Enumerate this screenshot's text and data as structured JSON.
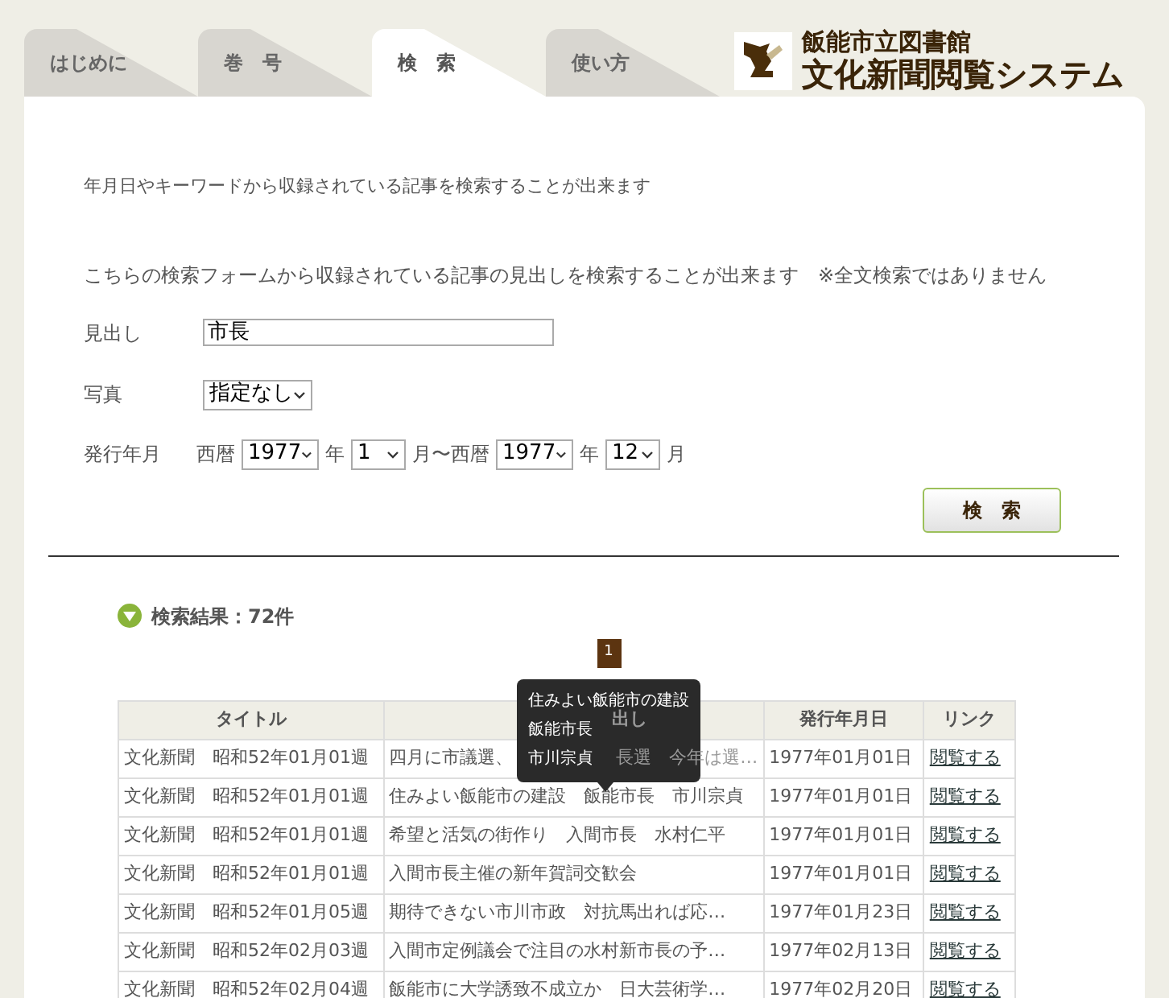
{
  "tabs": [
    {
      "label": "はじめに",
      "selected": false
    },
    {
      "label": "巻　号",
      "selected": false
    },
    {
      "label": "検　索",
      "selected": true
    },
    {
      "label": "使い方",
      "selected": false
    }
  ],
  "logo": {
    "subtitle": "飯能市立図書館",
    "title": "文化新聞閲覧システム"
  },
  "intro": "年月日やキーワードから収録されている記事を検索することが出来ます",
  "form": {
    "description": "こちらの検索フォームから収録されている記事の見出しを検索することが出来ます　※全文検索ではありません",
    "headline": {
      "label": "見出し",
      "value": "市長"
    },
    "photo": {
      "label": "写真",
      "value": "指定なし"
    },
    "date": {
      "label": "発行年月",
      "era_from": "西暦",
      "year_from": "1977",
      "year_unit_from": "年",
      "month_from": "1",
      "month_unit_from": "月〜西暦",
      "year_to": "1977",
      "year_unit_to": "年",
      "month_to": "12",
      "month_unit_to": "月"
    },
    "submit": "検　索"
  },
  "results": {
    "title": "検索結果：72件",
    "pages": [
      {
        "label": "1",
        "selected": true
      }
    ],
    "tooltip": [
      "住みよい飯能市の建設",
      "飯能市長",
      "市川宗貞"
    ],
    "columns": [
      "タイトル",
      "出し",
      "発行年月日",
      "リンク"
    ],
    "rows": [
      {
        "title": "文化新聞　昭和52年01月01週",
        "headline": "四月に市議選、",
        "headline_after": "長選　今年は選…",
        "date": "1977年01月01日",
        "link": "閲覧する"
      },
      {
        "title": "文化新聞　昭和52年01月01週",
        "headline": "住みよい飯能市の建設　飯能市長　市川宗貞",
        "date": "1977年01月01日",
        "link": "閲覧する"
      },
      {
        "title": "文化新聞　昭和52年01月01週",
        "headline": "希望と活気の街作り　入間市長　水村仁平",
        "date": "1977年01月01日",
        "link": "閲覧する"
      },
      {
        "title": "文化新聞　昭和52年01月01週",
        "headline": "入間市長主催の新年賀詞交歓会",
        "date": "1977年01月01日",
        "link": "閲覧する"
      },
      {
        "title": "文化新聞　昭和52年01月05週",
        "headline": "期待できない市川市政　対抗馬出れば応…",
        "date": "1977年01月23日",
        "link": "閲覧する"
      },
      {
        "title": "文化新聞　昭和52年02月03週",
        "headline": "入間市定例議会で注目の水村新市長の予…",
        "date": "1977年02月13日",
        "link": "閲覧する"
      },
      {
        "title": "文化新聞　昭和52年02月04週",
        "headline": "飯能市に大学誘致不成立か　日大芸術学…",
        "date": "1977年02月20日",
        "link": "閲覧する"
      }
    ]
  }
}
